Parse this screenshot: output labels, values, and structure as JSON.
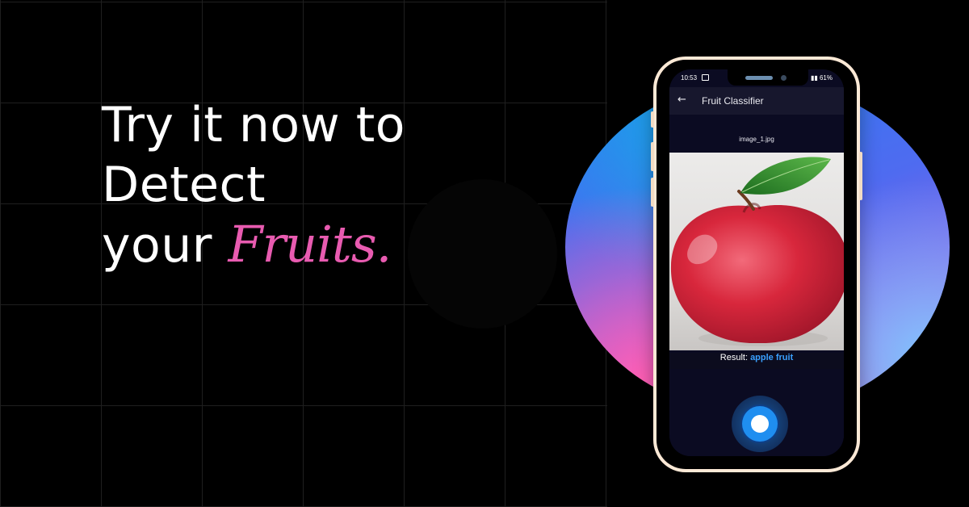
{
  "headline": {
    "line1": "Try it now to",
    "line2": "Detect",
    "line3_prefix": "your ",
    "line3_accent": "Fruits."
  },
  "colors": {
    "accent": "#e85bb0",
    "result_value": "#3aa0ff",
    "phone_frame": "#fbe9d6"
  },
  "status_bar": {
    "time": "10:53",
    "right": "61%"
  },
  "app_bar": {
    "back_icon": "arrow-left-icon",
    "title": "Fruit Classifier"
  },
  "image": {
    "filename": "image_1.jpg"
  },
  "result": {
    "label": "Result: ",
    "value": "apple fruit"
  },
  "capture_icon": "shutter-icon"
}
